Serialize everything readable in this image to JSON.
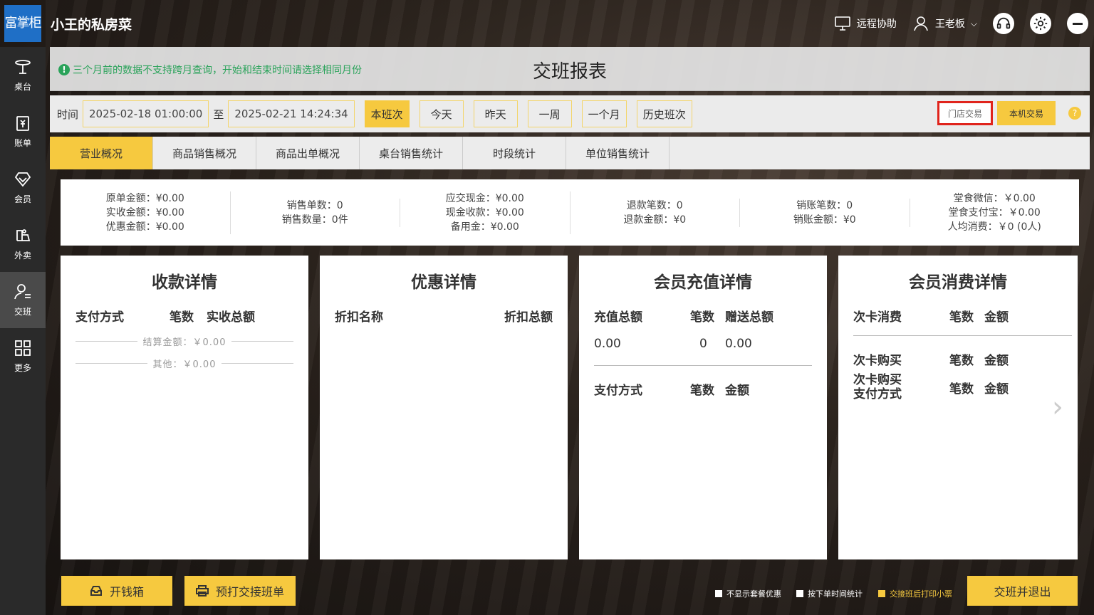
{
  "app": {
    "logo_text": "富掌柜",
    "store_name": "小王的私房菜",
    "remote_help": "远程协助",
    "user_name": "王老板"
  },
  "sidebar": {
    "items": [
      {
        "label": "桌台",
        "icon": "table-icon"
      },
      {
        "label": "账单",
        "icon": "bill-icon"
      },
      {
        "label": "会员",
        "icon": "member-icon"
      },
      {
        "label": "外卖",
        "icon": "delivery-icon"
      },
      {
        "label": "交班",
        "icon": "shift-icon"
      },
      {
        "label": "更多",
        "icon": "grid-icon"
      }
    ],
    "active_index": 4
  },
  "header": {
    "notice": "三个月前的数据不支持跨月查询，开始和结束时间请选择相同月份",
    "title": "交班报表"
  },
  "filter": {
    "time_label": "时间",
    "start": "2025-02-18 01:00:00",
    "to_label": "至",
    "end": "2025-02-21 14:24:34",
    "quick": [
      "本班次",
      "今天",
      "昨天",
      "一周",
      "一个月",
      "历史班次"
    ],
    "active_quick": 0,
    "store_tx": "门店交易",
    "local_tx": "本机交易",
    "help": "?"
  },
  "tabs": [
    "营业概况",
    "商品销售概况",
    "商品出单概况",
    "桌台销售统计",
    "时段统计",
    "单位销售统计"
  ],
  "summary": [
    [
      "原单金额：¥0.00",
      "实收金额：¥0.00",
      "优惠金额：¥0.00"
    ],
    [
      "销售单数：0",
      "销售数量：0件"
    ],
    [
      "应交现金：¥0.00",
      "现金收款：¥0.00",
      "备用金：¥0.00"
    ],
    [
      "退款笔数：0",
      "退款金额：¥0"
    ],
    [
      "销账笔数：0",
      "销账金额：¥0"
    ],
    [
      "堂食微信：￥0.00",
      "堂食支付宝：￥0.00",
      "人均消费：￥0 (0人)"
    ]
  ],
  "cards": {
    "payment": {
      "title": "收款详情",
      "h1": "支付方式",
      "h2": "笔数",
      "h3": "实收总额",
      "settle": "结算金额：￥0.00",
      "other": "其他：￥0.00"
    },
    "discount": {
      "title": "优惠详情",
      "h1": "折扣名称",
      "h2": "折扣总额"
    },
    "recharge": {
      "title": "会员充值详情",
      "h1": "充值总额",
      "h2": "笔数",
      "h3": "赠送总额",
      "v1": "0.00",
      "v2": "0",
      "v3": "0.00",
      "p1": "支付方式",
      "p2": "笔数",
      "p3": "金额"
    },
    "consume": {
      "title": "会员消费详情",
      "h1": "次卡消费",
      "h2": "笔数",
      "h3": "金额",
      "b1": "次卡购买",
      "b2": "笔数",
      "b3": "金额",
      "c1a": "次卡购买",
      "c1b": "支付方式",
      "c2": "笔数",
      "c3": "金额"
    }
  },
  "bottom": {
    "open_drawer": "开钱箱",
    "pre_print": "预打交接班单",
    "chk1": "不显示套餐优惠",
    "chk2": "按下单时间统计",
    "chk3": "交接班后打印小票",
    "submit": "交班并退出"
  },
  "colors": {
    "accent": "#f6c93f",
    "highlight": "#e0241c",
    "notice": "#2aa35a",
    "logo_bg": "#1f6fc6"
  }
}
